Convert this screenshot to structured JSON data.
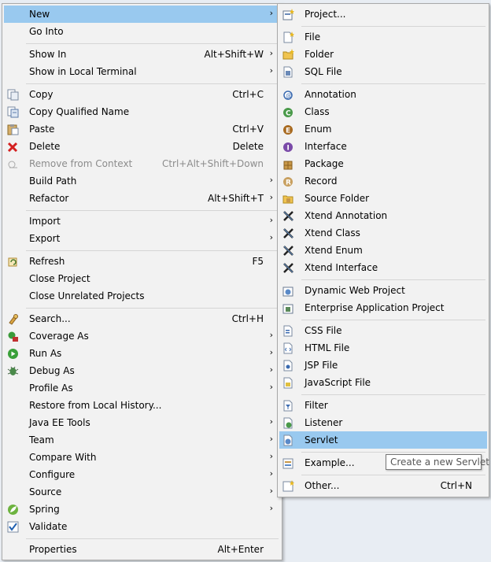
{
  "menu1": {
    "items": [
      {
        "label": "New",
        "shortcut": "",
        "submenu": true,
        "icon": "none",
        "highlight": true
      },
      {
        "label": "Go Into",
        "shortcut": "",
        "submenu": false,
        "icon": "none"
      },
      {
        "label": "Show In",
        "shortcut": "Alt+Shift+W",
        "submenu": true,
        "icon": "none"
      },
      {
        "label": "Show in Local Terminal",
        "shortcut": "",
        "submenu": true,
        "icon": "none"
      },
      {
        "label": "Copy",
        "shortcut": "Ctrl+C",
        "submenu": false,
        "icon": "copy-icon"
      },
      {
        "label": "Copy Qualified Name",
        "shortcut": "",
        "submenu": false,
        "icon": "copy-qualified-name-icon"
      },
      {
        "label": "Paste",
        "shortcut": "Ctrl+V",
        "submenu": false,
        "icon": "paste-icon"
      },
      {
        "label": "Delete",
        "shortcut": "Delete",
        "submenu": false,
        "icon": "delete-icon"
      },
      {
        "label": "Remove from Context",
        "shortcut": "Ctrl+Alt+Shift+Down",
        "submenu": false,
        "icon": "remove-from-context-icon",
        "disabled": true
      },
      {
        "label": "Build Path",
        "shortcut": "",
        "submenu": true,
        "icon": "none"
      },
      {
        "label": "Refactor",
        "shortcut": "Alt+Shift+T",
        "submenu": true,
        "icon": "none"
      },
      {
        "label": "Import",
        "shortcut": "",
        "submenu": true,
        "icon": "none"
      },
      {
        "label": "Export",
        "shortcut": "",
        "submenu": true,
        "icon": "none"
      },
      {
        "label": "Refresh",
        "shortcut": "F5",
        "submenu": false,
        "icon": "refresh-icon"
      },
      {
        "label": "Close Project",
        "shortcut": "",
        "submenu": false,
        "icon": "none"
      },
      {
        "label": "Close Unrelated Projects",
        "shortcut": "",
        "submenu": false,
        "icon": "none"
      },
      {
        "label": "Search...",
        "shortcut": "Ctrl+H",
        "submenu": false,
        "icon": "search-icon"
      },
      {
        "label": "Coverage As",
        "shortcut": "",
        "submenu": true,
        "icon": "coverage-icon"
      },
      {
        "label": "Run As",
        "shortcut": "",
        "submenu": true,
        "icon": "run-icon"
      },
      {
        "label": "Debug As",
        "shortcut": "",
        "submenu": true,
        "icon": "debug-icon"
      },
      {
        "label": "Profile As",
        "shortcut": "",
        "submenu": true,
        "icon": "none"
      },
      {
        "label": "Restore from Local History...",
        "shortcut": "",
        "submenu": false,
        "icon": "none"
      },
      {
        "label": "Java EE Tools",
        "shortcut": "",
        "submenu": true,
        "icon": "none"
      },
      {
        "label": "Team",
        "shortcut": "",
        "submenu": true,
        "icon": "none"
      },
      {
        "label": "Compare With",
        "shortcut": "",
        "submenu": true,
        "icon": "none"
      },
      {
        "label": "Configure",
        "shortcut": "",
        "submenu": true,
        "icon": "none"
      },
      {
        "label": "Source",
        "shortcut": "",
        "submenu": true,
        "icon": "none"
      },
      {
        "label": "Spring",
        "shortcut": "",
        "submenu": true,
        "icon": "spring-icon"
      },
      {
        "label": "Validate",
        "shortcut": "",
        "submenu": false,
        "icon": "validate-icon"
      },
      {
        "label": "Properties",
        "shortcut": "Alt+Enter",
        "submenu": false,
        "icon": "none"
      }
    ]
  },
  "menu2": {
    "items": [
      {
        "label": "Project...",
        "shortcut": "",
        "icon": "new-project-icon"
      },
      {
        "label": "File",
        "shortcut": "",
        "icon": "new-file-icon"
      },
      {
        "label": "Folder",
        "shortcut": "",
        "icon": "new-folder-icon"
      },
      {
        "label": "SQL File",
        "shortcut": "",
        "icon": "sql-file-icon"
      },
      {
        "label": "Annotation",
        "shortcut": "",
        "icon": "annotation-icon"
      },
      {
        "label": "Class",
        "shortcut": "",
        "icon": "class-icon"
      },
      {
        "label": "Enum",
        "shortcut": "",
        "icon": "enum-icon"
      },
      {
        "label": "Interface",
        "shortcut": "",
        "icon": "interface-icon"
      },
      {
        "label": "Package",
        "shortcut": "",
        "icon": "package-icon"
      },
      {
        "label": "Record",
        "shortcut": "",
        "icon": "record-icon"
      },
      {
        "label": "Source Folder",
        "shortcut": "",
        "icon": "source-folder-icon"
      },
      {
        "label": "Xtend Annotation",
        "shortcut": "",
        "icon": "xtend-annotation-icon"
      },
      {
        "label": "Xtend Class",
        "shortcut": "",
        "icon": "xtend-class-icon"
      },
      {
        "label": "Xtend Enum",
        "shortcut": "",
        "icon": "xtend-enum-icon"
      },
      {
        "label": "Xtend Interface",
        "shortcut": "",
        "icon": "xtend-interface-icon"
      },
      {
        "label": "Dynamic Web Project",
        "shortcut": "",
        "icon": "dynamic-web-project-icon"
      },
      {
        "label": "Enterprise Application Project",
        "shortcut": "",
        "icon": "enterprise-application-project-icon"
      },
      {
        "label": "CSS File",
        "shortcut": "",
        "icon": "css-file-icon"
      },
      {
        "label": "HTML File",
        "shortcut": "",
        "icon": "html-file-icon"
      },
      {
        "label": "JSP File",
        "shortcut": "",
        "icon": "jsp-file-icon"
      },
      {
        "label": "JavaScript File",
        "shortcut": "",
        "icon": "javascript-file-icon"
      },
      {
        "label": "Filter",
        "shortcut": "",
        "icon": "filter-icon"
      },
      {
        "label": "Listener",
        "shortcut": "",
        "icon": "listener-icon"
      },
      {
        "label": "Servlet",
        "shortcut": "",
        "icon": "servlet-icon",
        "highlight": true
      },
      {
        "label": "Example...",
        "shortcut": "",
        "icon": "example-icon"
      },
      {
        "label": "Other...",
        "shortcut": "Ctrl+N",
        "icon": "other-icon"
      }
    ]
  },
  "tooltip": {
    "text": "Create a new Servlet"
  },
  "colors": {
    "highlight": "#99c9ef",
    "menu_bg": "#f2f2f2",
    "disabled_text": "#8c8c8c"
  }
}
